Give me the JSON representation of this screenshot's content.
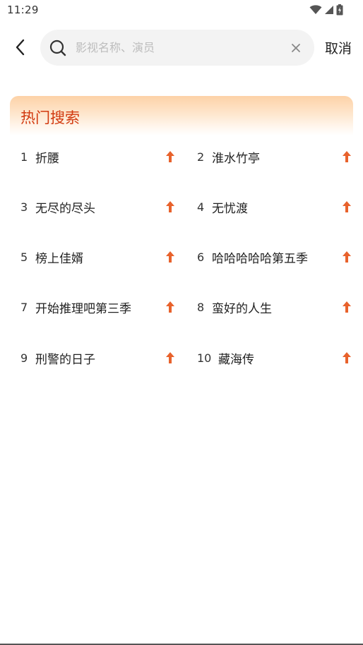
{
  "status_bar": {
    "time": "11:29"
  },
  "search": {
    "placeholder": "影视名称、演员",
    "value": "",
    "cancel_label": "取消"
  },
  "hot_search": {
    "title": "热门搜索",
    "items": [
      {
        "rank": "1",
        "name": "折腰",
        "trend": "up"
      },
      {
        "rank": "2",
        "name": "淮水竹亭",
        "trend": "up"
      },
      {
        "rank": "3",
        "name": "无尽的尽头",
        "trend": "up"
      },
      {
        "rank": "4",
        "name": "无忧渡",
        "trend": "up"
      },
      {
        "rank": "5",
        "name": "榜上佳婿",
        "trend": "up"
      },
      {
        "rank": "6",
        "name": "哈哈哈哈哈第五季",
        "trend": "up"
      },
      {
        "rank": "7",
        "name": "开始推理吧第三季",
        "trend": "up"
      },
      {
        "rank": "8",
        "name": "蛮好的人生",
        "trend": "up"
      },
      {
        "rank": "9",
        "name": "刑警的日子",
        "trend": "up"
      },
      {
        "rank": "10",
        "name": "藏海传",
        "trend": "up"
      }
    ]
  },
  "colors": {
    "accent": "#d23a10",
    "trend_up": "#e8622c",
    "search_bg": "#f3f3f3"
  }
}
